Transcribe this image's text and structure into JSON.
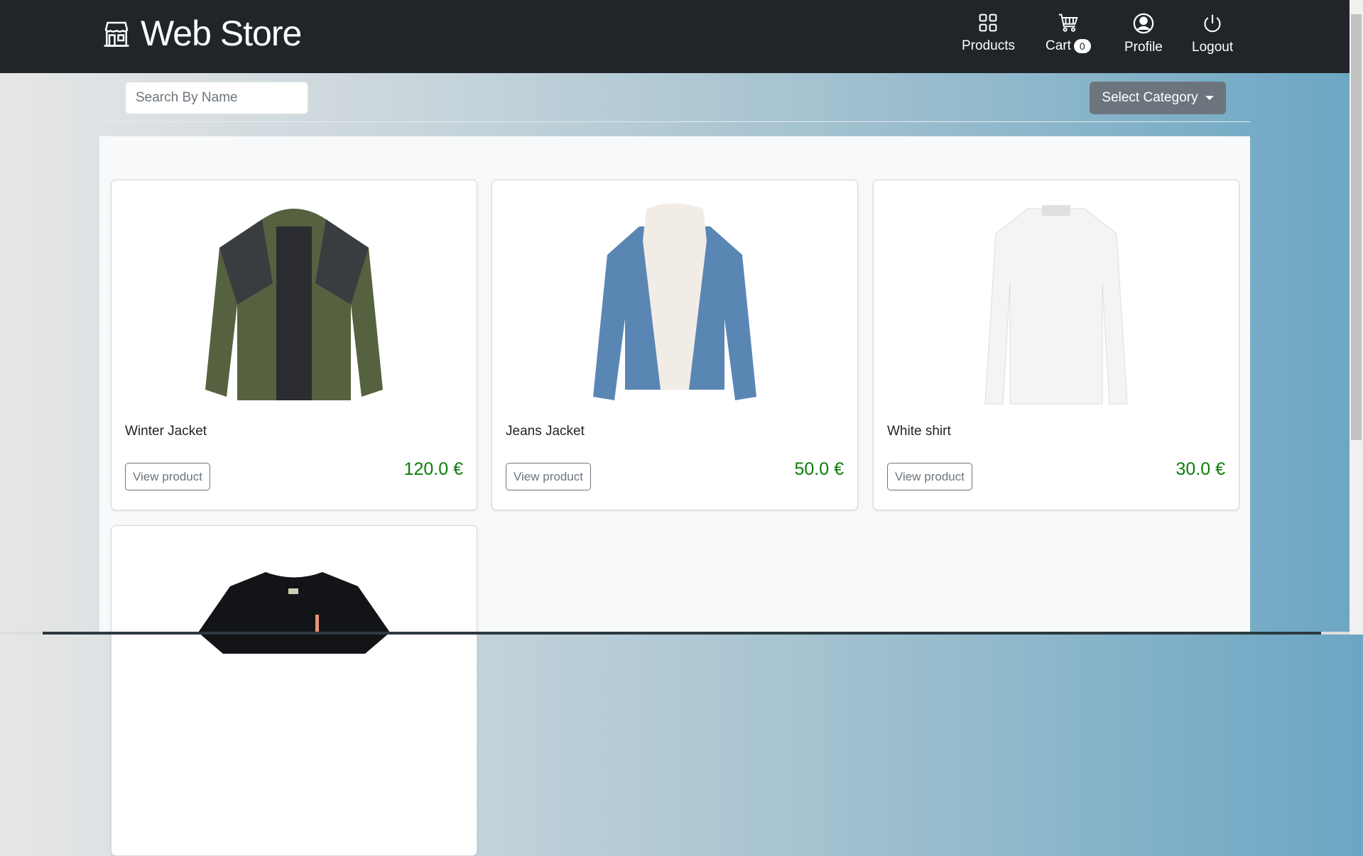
{
  "header": {
    "brand": "Web Store",
    "nav": [
      {
        "label": "Products",
        "icon": "grid-icon"
      },
      {
        "label": "Cart",
        "icon": "cart-icon",
        "badge": "0"
      },
      {
        "label": "Profile",
        "icon": "user-circle-icon"
      },
      {
        "label": "Logout",
        "icon": "power-icon"
      }
    ]
  },
  "toolbar": {
    "search_placeholder": "Search By Name",
    "category_label": "Select Category"
  },
  "products": [
    {
      "name": "Winter Jacket",
      "price": "120.0 €",
      "button": "View product"
    },
    {
      "name": "Jeans Jacket",
      "price": "50.0 €",
      "button": "View product"
    },
    {
      "name": "White shirt",
      "price": "30.0 €",
      "button": "View product"
    },
    {
      "name": "",
      "price": "",
      "button": ""
    }
  ],
  "colors": {
    "header": "#212529",
    "price": "#0a7d0a",
    "category_button": "#6c757d"
  }
}
